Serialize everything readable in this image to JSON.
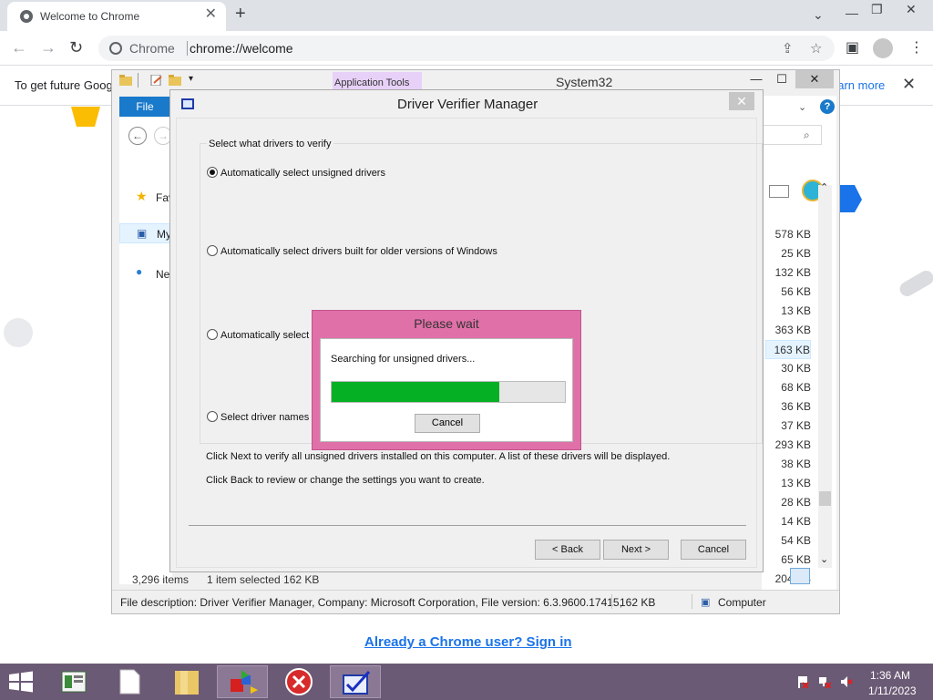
{
  "chrome": {
    "tab_title": "Welcome to Chrome",
    "tab_close": "✕",
    "new_tab": "+",
    "omnibox_label": "Chrome",
    "url": "chrome://welcome",
    "window_controls": [
      "⌄",
      "—",
      "❐",
      "✕"
    ],
    "infobar_text": "To get future Goog",
    "infobar_link": "earn more",
    "infobar_close": "✕",
    "signin_link": "Already a Chrome user? Sign in"
  },
  "explorer": {
    "caption": "System32",
    "app_tools": "Application Tools",
    "file_tab": "File",
    "window_controls": [
      "—",
      "☐",
      "✕"
    ],
    "nav_items": [
      "Fav",
      "My",
      "Ne"
    ],
    "sizes": [
      "578 KB",
      "25 KB",
      "132 KB",
      "56 KB",
      "13 KB",
      "363 KB",
      "163 KB",
      "30 KB",
      "68 KB",
      "36 KB",
      "37 KB",
      "293 KB",
      "38 KB",
      "13 KB",
      "28 KB",
      "14 KB",
      "54 KB",
      "65 KB",
      "204 KB"
    ],
    "selected_size_index": 6,
    "item_count": "3,296 items",
    "selection_status": "1 item selected  162 KB",
    "file_description": "File description: Driver Verifier Manager, Company: Microsoft Corporation, File version: 6.3.9600.17415,",
    "file_size": "162 KB",
    "location": "Computer"
  },
  "verifier": {
    "title": "Driver Verifier Manager",
    "group_label": "Select what drivers to verify",
    "options": [
      "Automatically select unsigned drivers",
      "Automatically select drivers built for older versions of Windows",
      "Automatically select a",
      "Select driver names fr"
    ],
    "selected_option": 0,
    "info_1": "Click Next to verify all unsigned drivers installed on this computer. A list of these drivers will be displayed.",
    "info_2": "Click Back to review or change the settings you want to create.",
    "back_label": "< Back",
    "next_label": "Next >",
    "cancel_label": "Cancel",
    "close": "✕"
  },
  "please_wait": {
    "title": "Please wait",
    "message": "Searching for unsigned drivers...",
    "progress": 0.72,
    "cancel_label": "Cancel",
    "progress_color": "#06b025"
  },
  "taskbar": {
    "time": "1:36 AM",
    "date": "1/11/2023",
    "accent": "#6b5a75"
  }
}
